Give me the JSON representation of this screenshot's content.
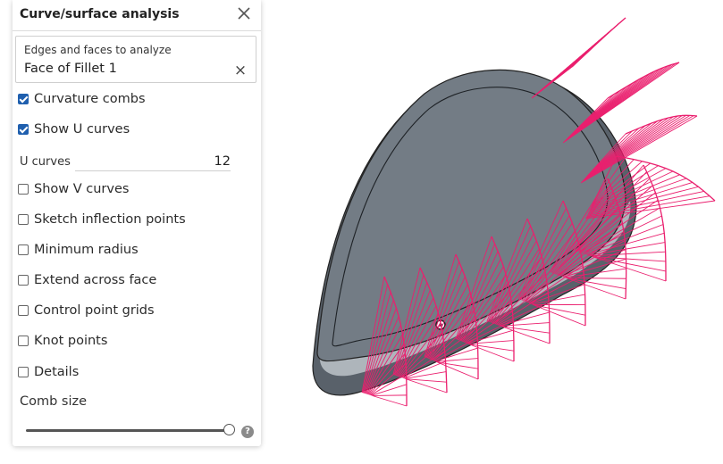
{
  "panel": {
    "title": "Curve/surface analysis",
    "close_icon": "close-icon",
    "selection": {
      "label": "Edges and faces to analyze",
      "value": "Face of Fillet 1",
      "clear_glyph": "×"
    },
    "options": [
      {
        "label": "Curvature combs",
        "checked": true
      },
      {
        "label": "Show U curves",
        "checked": true
      },
      {
        "label": "Show V curves",
        "checked": false
      },
      {
        "label": "Sketch inflection points",
        "checked": false
      },
      {
        "label": "Minimum radius",
        "checked": false
      },
      {
        "label": "Extend across face",
        "checked": false
      },
      {
        "label": "Control point grids",
        "checked": false
      },
      {
        "label": "Knot points",
        "checked": false
      },
      {
        "label": "Details",
        "checked": false
      }
    ],
    "u_curves": {
      "label": "U curves",
      "value": "12"
    },
    "comb_size": {
      "label": "Comb size",
      "value_fraction": 1.0
    },
    "help_glyph": "?"
  },
  "viewport": {
    "model": "guitar-pick shaped solid body",
    "body_color": "#6b747c",
    "fillet_color": "#9aa2a9",
    "comb_color": "#ea1f6e"
  }
}
